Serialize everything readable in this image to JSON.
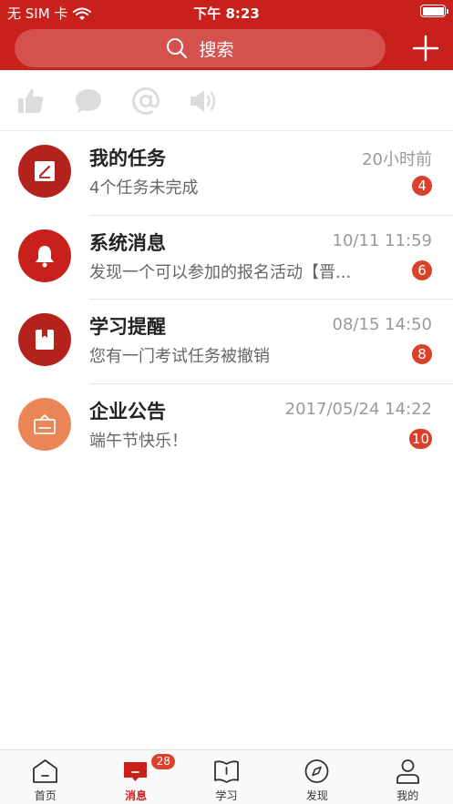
{
  "status_bar": {
    "carrier": "无 SIM 卡",
    "time": "下午 8:23",
    "battery_level": 1.0
  },
  "search": {
    "placeholder": "搜索"
  },
  "toolbar": {
    "icons": [
      "thumbs-up-icon",
      "chat-bubble-icon",
      "at-icon",
      "speaker-icon"
    ]
  },
  "messages": [
    {
      "title": "我的任务",
      "time": "20小时前",
      "preview": "4个任务未完成",
      "badge": "4",
      "icon": "task-edit-icon",
      "color": "#b3231b"
    },
    {
      "title": "系统消息",
      "time": "10/11 11:59",
      "preview": "发现一个可以参加的报名活动【晋...",
      "badge": "6",
      "icon": "bell-icon",
      "color": "#c8211b"
    },
    {
      "title": "学习提醒",
      "time": "08/15 14:50",
      "preview": "您有一门考试任务被撤销",
      "badge": "8",
      "icon": "bookmark-icon",
      "color": "#b3231b"
    },
    {
      "title": "企业公告",
      "time": "2017/05/24 14:22",
      "preview": "端午节快乐！",
      "badge": "10",
      "icon": "announcement-box-icon",
      "color": "#ea8656"
    }
  ],
  "tabbar": {
    "tabs": [
      {
        "label": "首页",
        "icon": "home-icon"
      },
      {
        "label": "消息",
        "icon": "message-icon",
        "badge": "28",
        "active": true
      },
      {
        "label": "学习",
        "icon": "book-icon"
      },
      {
        "label": "发现",
        "icon": "compass-icon"
      },
      {
        "label": "我的",
        "icon": "person-icon"
      }
    ]
  },
  "colors": {
    "brand": "#c8211b",
    "badge": "#d9412b",
    "inactive_icon": "#dcdcdc"
  }
}
